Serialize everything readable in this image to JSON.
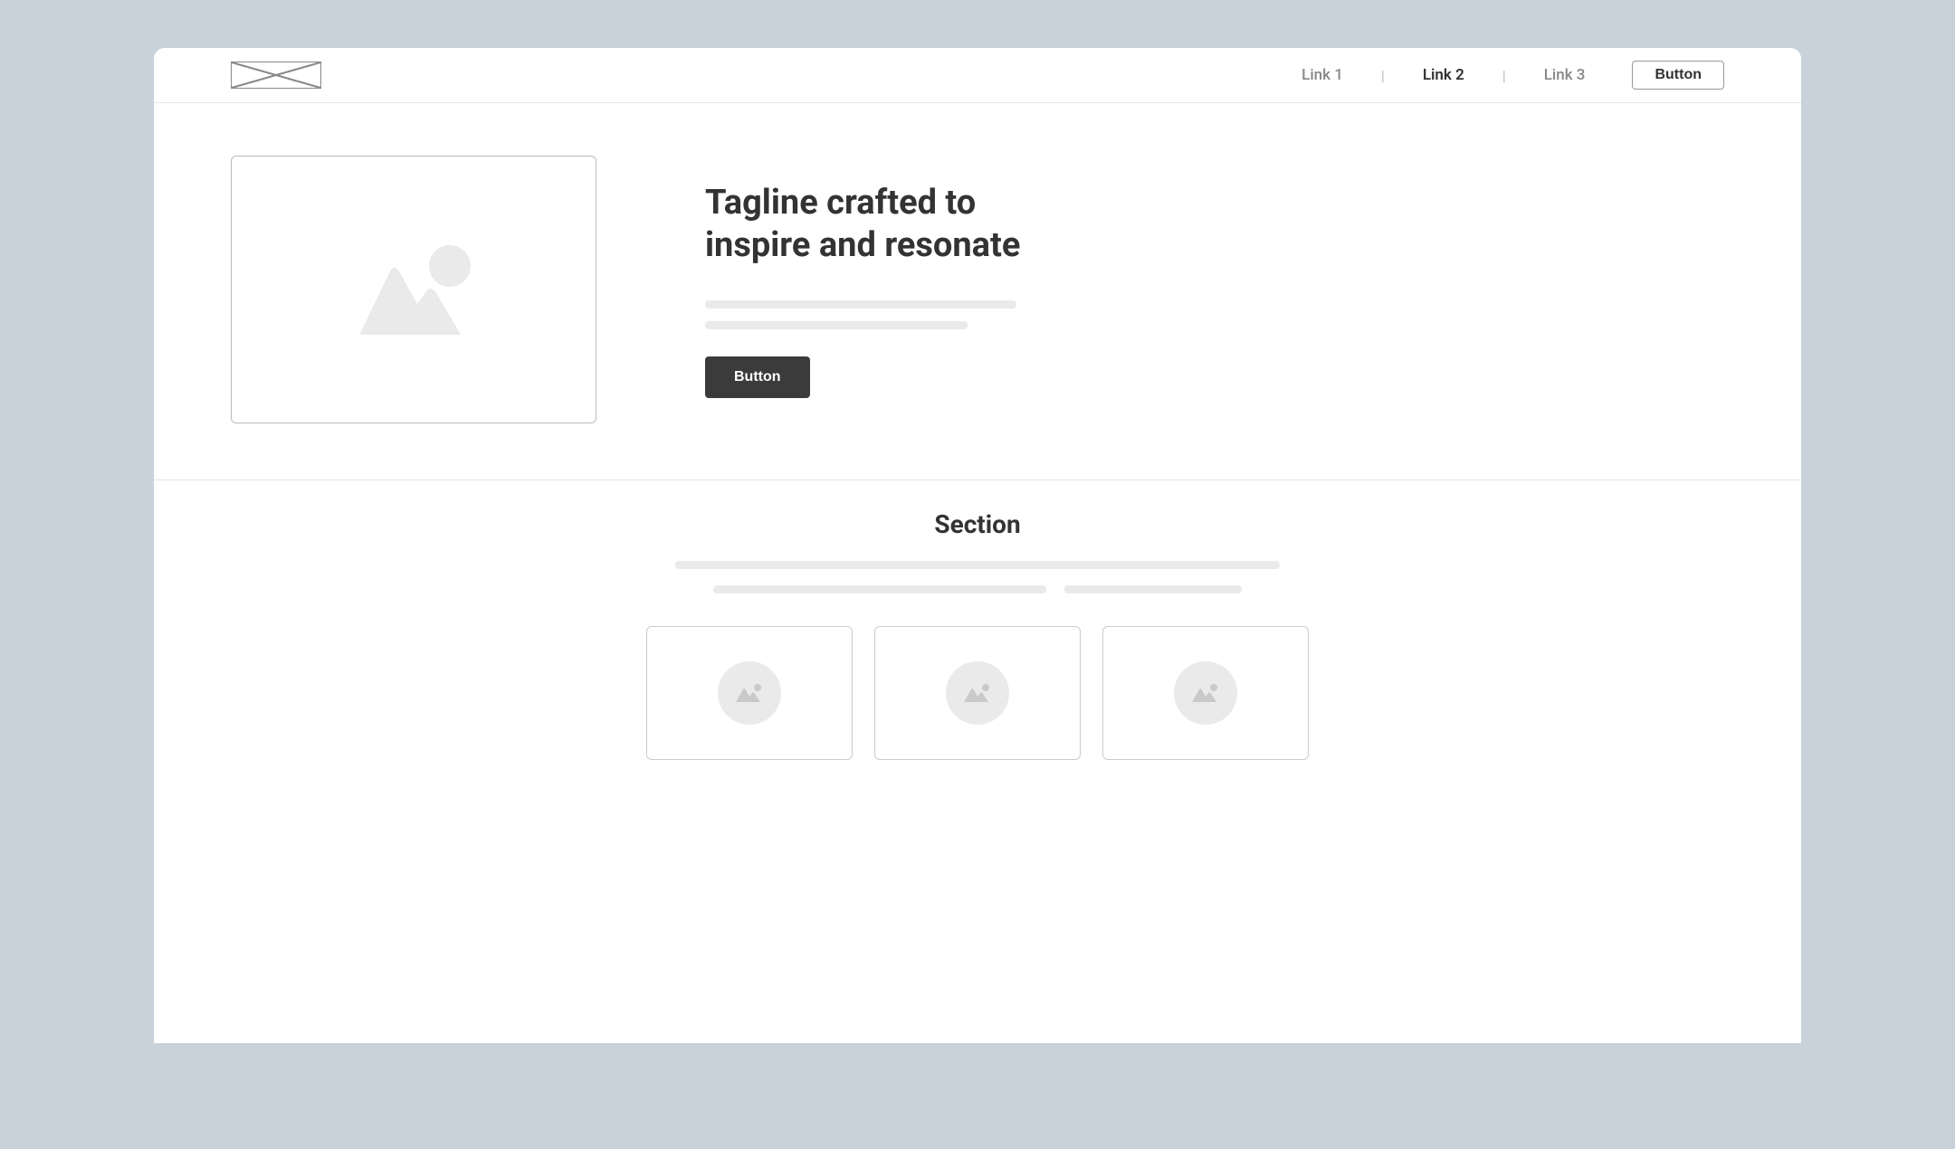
{
  "header": {
    "links": [
      "Link 1",
      "Link 2",
      "Link 3"
    ],
    "active_link_index": 1,
    "button_label": "Button"
  },
  "hero": {
    "title": "Tagline crafted to inspire and resonate",
    "button_label": "Button"
  },
  "section": {
    "title": "Section"
  }
}
